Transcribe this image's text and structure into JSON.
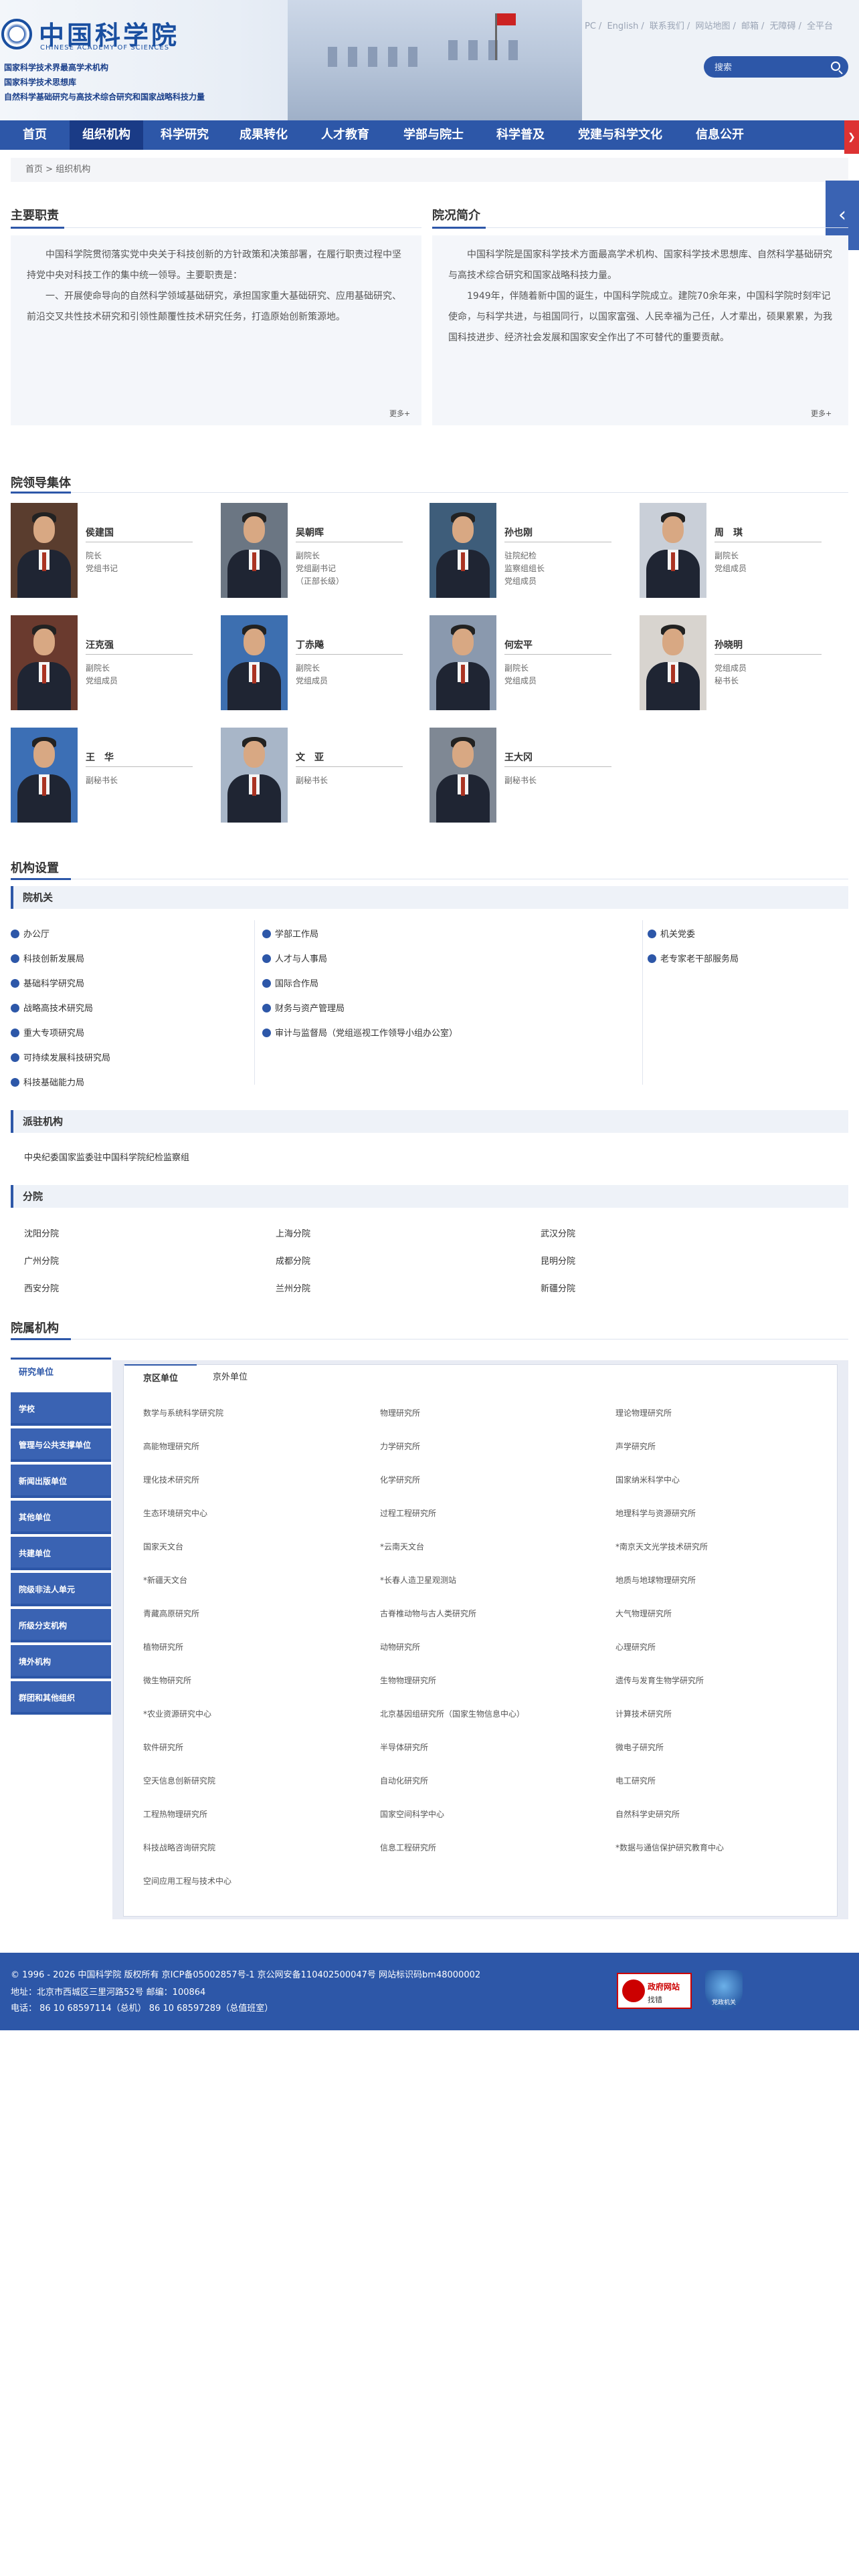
{
  "header": {
    "logo_cn": "中国科学院",
    "logo_en": "CHINESE ACADEMY OF SCIENCES",
    "taglines": [
      "国家科学技术界最高学术机构",
      "国家科学技术思想库",
      "自然科学基础研究与高技术综合研究和国家战略科技力量"
    ],
    "top_links": [
      "PC",
      "English",
      "联系我们",
      "网站地图",
      "邮箱",
      "无障碍",
      "全平台"
    ],
    "search_placeholder": "搜索"
  },
  "nav": {
    "items": [
      "首页",
      "组织机构",
      "科学研究",
      "成果转化",
      "人才教育",
      "学部与院士",
      "科学普及",
      "党建与科学文化",
      "信息公开"
    ],
    "active_index": 1
  },
  "breadcrumb": {
    "home": "首页",
    "sep": ">",
    "current": "组织机构"
  },
  "duties": {
    "title": "主要职责",
    "paragraphs": [
      "中国科学院贯彻落实党中央关于科技创新的方针政策和决策部署，在履行职责过程中坚持党中央对科技工作的集中统一领导。主要职责是：",
      "一、开展使命导向的自然科学领域基础研究，承担国家重大基础研究、应用基础研究、前沿交叉共性技术研究和引领性颠覆性技术研究任务，打造原始创新策源地。"
    ],
    "more": "更多+"
  },
  "intro": {
    "title": "院况简介",
    "paragraphs": [
      "中国科学院是国家科学技术方面最高学术机构、国家科学技术思想库、自然科学基础研究与高技术综合研究和国家战略科技力量。",
      "1949年，伴随着新中国的诞生，中国科学院成立。建院70余年来，中国科学院时刻牢记使命，与科学共进，与祖国同行，以国家富强、人民幸福为己任，人才辈出，硕果累累，为我国科技进步、经济社会发展和国家安全作出了不可替代的重要贡献。"
    ],
    "more": "更多+"
  },
  "leaders": {
    "title": "院领导集体",
    "people": [
      {
        "name": "侯建国",
        "roles": [
          "院长",
          "党组书记"
        ]
      },
      {
        "name": "吴朝晖",
        "roles": [
          "副院长",
          "党组副书记",
          "（正部长级）"
        ]
      },
      {
        "name": "孙也刚",
        "roles": [
          "驻院纪检",
          "监察组组长",
          "党组成员"
        ]
      },
      {
        "name": "周　琪",
        "roles": [
          "副院长",
          "党组成员"
        ]
      },
      {
        "name": "汪克强",
        "roles": [
          "副院长",
          "党组成员"
        ]
      },
      {
        "name": "丁赤飚",
        "roles": [
          "副院长",
          "党组成员"
        ]
      },
      {
        "name": "何宏平",
        "roles": [
          "副院长",
          "党组成员"
        ]
      },
      {
        "name": "孙晓明",
        "roles": [
          "党组成员",
          "秘书长"
        ]
      },
      {
        "name": "王　华",
        "roles": [
          "副秘书长"
        ]
      },
      {
        "name": "文　亚",
        "roles": [
          "副秘书长"
        ]
      },
      {
        "name": "王大冈",
        "roles": [
          "副秘书长"
        ]
      }
    ]
  },
  "org": {
    "title": "机构设置",
    "hq": {
      "title": "院机关",
      "col1": [
        "办公厅",
        "科技创新发展局",
        "基础科学研究局",
        "战略高技术研究局",
        "重大专项研究局",
        "可持续发展科技研究局",
        "科技基础能力局"
      ],
      "col2": [
        "学部工作局",
        "人才与人事局",
        "国际合作局",
        "财务与资产管理局",
        "审计与监督局（党组巡视工作领导小组办公室）"
      ],
      "col3": [
        "机关党委",
        "老专家老干部服务局"
      ]
    },
    "stationed": {
      "title": "派驻机构",
      "items": [
        "中央纪委国家监委驻中国科学院纪检监察组"
      ]
    },
    "branches": {
      "title": "分院",
      "items": [
        "沈阳分院",
        "上海分院",
        "武汉分院",
        "广州分院",
        "成都分院",
        "昆明分院",
        "西安分院",
        "兰州分院",
        "新疆分院"
      ]
    }
  },
  "affiliated": {
    "title": "院属机构",
    "side_tabs": [
      "研究单位",
      "学校",
      "管理与公共支撑单位",
      "新闻出版单位",
      "其他单位",
      "共建单位",
      "院级非法人单元",
      "所级分支机构",
      "境外机构",
      "群团和其他组织"
    ],
    "sub_tabs": [
      "京区单位",
      "京外单位"
    ],
    "institutes": [
      "数学与系统科学研究院",
      "物理研究所",
      "理论物理研究所",
      "高能物理研究所",
      "力学研究所",
      "声学研究所",
      "理化技术研究所",
      "化学研究所",
      "国家纳米科学中心",
      "生态环境研究中心",
      "过程工程研究所",
      "地理科学与资源研究所",
      "国家天文台",
      "*云南天文台",
      "*南京天文光学技术研究所",
      "*新疆天文台",
      "*长春人造卫星观测站",
      "地质与地球物理研究所",
      "青藏高原研究所",
      "古脊椎动物与古人类研究所",
      "大气物理研究所",
      "植物研究所",
      "动物研究所",
      "心理研究所",
      "微生物研究所",
      "生物物理研究所",
      "遗传与发育生物学研究所",
      "*农业资源研究中心",
      "北京基因组研究所（国家生物信息中心）",
      "计算技术研究所",
      "软件研究所",
      "半导体研究所",
      "微电子研究所",
      "空天信息创新研究院",
      "自动化研究所",
      "电工研究所",
      "工程热物理研究所",
      "国家空间科学中心",
      "自然科学史研究所",
      "科技战略咨询研究院",
      "信息工程研究所",
      "*数据与通信保护研究教育中心",
      "空间应用工程与技术中心"
    ]
  },
  "footer": {
    "line1": "© 1996 - 2026 中国科学院 版权所有   京ICP备05002857号-1   京公网安备110402500047号   网站标识码bm48000002",
    "line2": "地址：北京市西城区三里河路52号 邮编：100864",
    "line3": "电话：  86 10 68597114（总机）  86 10 68597289（总值班室）",
    "gov_badge_title": "政府网站",
    "gov_badge_sub": "找错",
    "party_badge": "党政机关"
  },
  "colors": {
    "primary": "#2d57a8",
    "dark": "#1a3b86",
    "accent_red": "#dd3333"
  }
}
